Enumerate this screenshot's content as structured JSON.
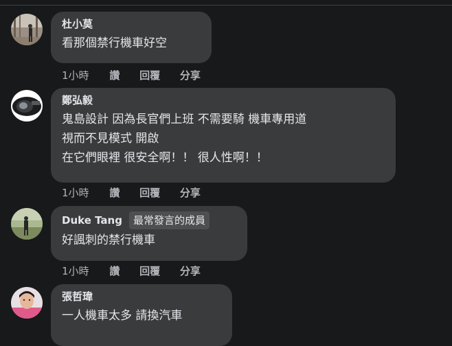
{
  "comments": [
    {
      "author": "杜小莫",
      "lines": [
        "看那個禁行機車好空"
      ],
      "time": "1小時",
      "like": "讚",
      "reply": "回覆",
      "share": "分享"
    },
    {
      "author": "鄭弘毅",
      "lines": [
        "鬼島設計 因為長官們上班 不需要騎 機車專用道",
        "視而不見模式 開啟",
        "在它們眼裡 很安全啊！！ 很人性啊！！"
      ],
      "time": "1小時",
      "like": "讚",
      "reply": "回覆",
      "share": "分享"
    },
    {
      "author": "Duke Tang",
      "badge": "最常發言的成員",
      "lines": [
        "好諷刺的禁行機車"
      ],
      "time": "1小時",
      "like": "讚",
      "reply": "回覆",
      "share": "分享"
    },
    {
      "author": "張哲瑋",
      "lines": [
        "一人機車太多 請換汽車"
      ]
    }
  ]
}
